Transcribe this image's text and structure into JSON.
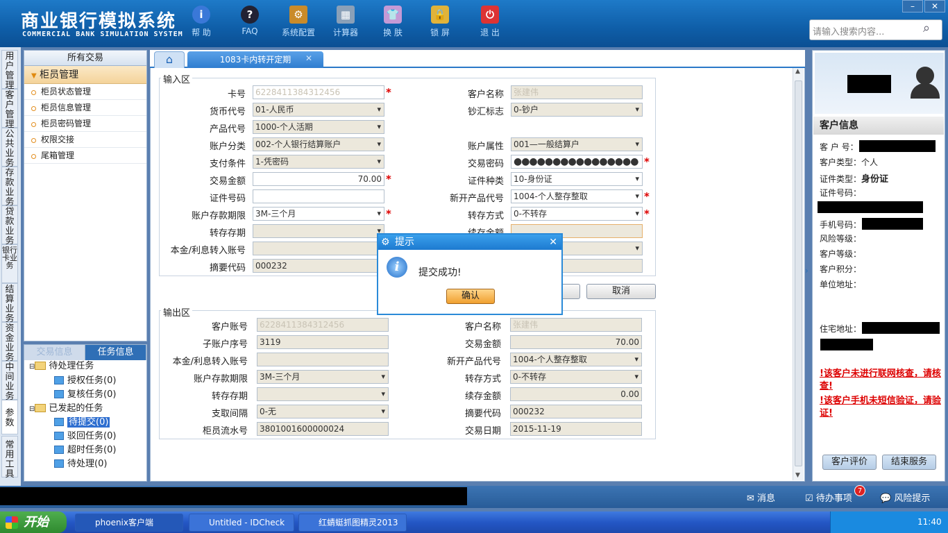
{
  "header": {
    "title_cn": "商业银行模拟系统",
    "title_en": "COMMERCIAL BANK SIMULATION SYSTEM",
    "toolbar": [
      {
        "label": "帮 助",
        "icon": "help-icon"
      },
      {
        "label": "FAQ",
        "icon": "faq-icon"
      },
      {
        "label": "系统配置",
        "icon": "settings-icon"
      },
      {
        "label": "计算器",
        "icon": "calculator-icon"
      },
      {
        "label": "换 肤",
        "icon": "skin-icon"
      },
      {
        "label": "锁 屏",
        "icon": "lock-icon"
      },
      {
        "label": "退 出",
        "icon": "power-icon"
      }
    ],
    "search_placeholder": "请输入搜索内容...",
    "min": "–",
    "close": "✕"
  },
  "vnav": [
    "用户管理",
    "客户管理",
    "公共业务",
    "存款业务",
    "贷款业务",
    "银行卡业务",
    "结算业务",
    "资金业务",
    "中间业务",
    "参数",
    "常用工具"
  ],
  "left": {
    "title": "所有交易",
    "group": "柜员管理",
    "items": [
      "柜员状态管理",
      "柜员信息管理",
      "柜员密码管理",
      "权限交接",
      "尾箱管理"
    ]
  },
  "tasks": {
    "tab1": "交易信息",
    "tab2": "任务信息",
    "tree": [
      "待处理任务",
      "授权任务(0)",
      "复核任务(0)",
      "已发起的任务",
      "待提交(0)",
      "驳回任务(0)",
      "超时任务(0)",
      "待处理(0)"
    ]
  },
  "tabs": {
    "home": "⌂",
    "active": "1083卡内转开定期",
    "close": "✕"
  },
  "input": {
    "title": "输入区",
    "card_no_label": "卡号",
    "card_no": "6228411384312456",
    "cust_name_label": "客户名称",
    "cust_name": "张建伟",
    "currency_label": "货币代号",
    "currency": "01-人民币",
    "cash_label": "钞汇标志",
    "cash": "0-钞户",
    "product_label": "产品代号",
    "product": "1000-个人活期",
    "acct_class_label": "账户分类",
    "acct_class": "002-个人银行结算账户",
    "acct_attr_label": "账户属性",
    "acct_attr": "001—一般结算户",
    "pay_cond_label": "支付条件",
    "pay_cond": "1-凭密码",
    "pwd_label": "交易密码",
    "pwd": "●●●●●●●●●●●●●●●●",
    "amount_label": "交易金额",
    "amount": "70.00",
    "id_type_label": "证件种类",
    "id_type": "10-身份证",
    "id_no_label": "证件号码",
    "id_no": "",
    "new_prod_label": "新开产品代号",
    "new_prod": "1004-个人整存整取",
    "term_label": "账户存款期限",
    "term": "3M-三个月",
    "transfer_label": "转存方式",
    "transfer": "0-不转存",
    "transfer_term_label": "转存存期",
    "transfer_term": "",
    "renew_label": "续存金额",
    "renew": "",
    "interest_acct_label": "本金/利息转入账号",
    "interest_acct": "",
    "summary_label": "摘要代码",
    "summary": "000232",
    "cancel": "取消"
  },
  "output": {
    "title": "输出区",
    "acct_label": "客户账号",
    "acct": "6228411384312456",
    "name_label": "客户名称",
    "name": "张建伟",
    "sub_label": "子账户序号",
    "sub": "3119",
    "amount_label": "交易金额",
    "amount": "70.00",
    "interest_label": "本金/利息转入账号",
    "interest": "",
    "new_prod_label": "新开产品代号",
    "new_prod": "1004-个人整存整取",
    "term_label": "账户存款期限",
    "term": "3M-三个月",
    "transfer_label": "转存方式",
    "transfer": "0-不转存",
    "transfer_term_label": "转存存期",
    "transfer_term": "",
    "renew_label": "续存金额",
    "renew": "0.00",
    "withdraw_label": "支取间隔",
    "withdraw": "0-无",
    "summary_label": "摘要代码",
    "summary": "000232",
    "teller_label": "柜员流水号",
    "teller": "3801001600000024",
    "date_label": "交易日期",
    "date": "2015-11-19"
  },
  "customer": {
    "title": "客户信息",
    "no": "客 户 号：",
    "type_label": "客户类型：",
    "type": "个人",
    "id_type_label": "证件类型：",
    "id_type": "身份证",
    "id_no": "证件号码：",
    "phone": "手机号码：",
    "risk": "风险等级：",
    "level": "客户等级：",
    "points": "客户积分：",
    "unit": "单位地址：",
    "home": "住宅地址：",
    "warn1": "!该客户未进行联网核查，请核查!",
    "warn2": "!该客户手机未短信验证，请验证!",
    "btn_eval": "客户评价",
    "btn_end": "结束服务"
  },
  "status": {
    "msg": "消息",
    "todo": "待办事项",
    "todo_count": "7",
    "risk": "风险提示"
  },
  "taskbar": {
    "start": "开始",
    "t1": "phoenix客户端",
    "t2": "Untitled - IDCheck",
    "t3": "红蜻蜓抓图精灵2013",
    "time": "11:40"
  },
  "dialog": {
    "title": "提示",
    "msg": "提交成功!",
    "ok": "确认",
    "close": "✕"
  }
}
